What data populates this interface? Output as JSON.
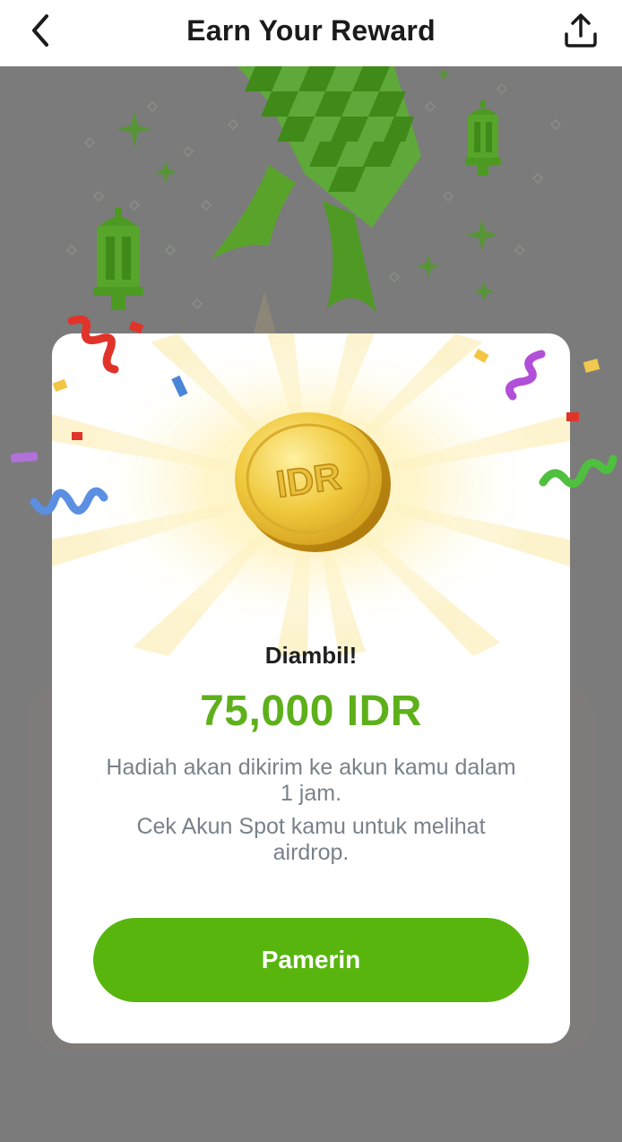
{
  "header": {
    "title": "Earn Your Reward",
    "back_icon": "chevron-left-icon",
    "share_icon": "share-upload-icon"
  },
  "reward": {
    "coin_label": "IDR",
    "status": "Diambil!",
    "amount": "75,000 IDR",
    "description_1": "Hadiah akan dikirim ke akun kamu dalam 1 jam.",
    "description_2": "Cek Akun Spot kamu untuk melihat airdrop.",
    "button_label": "Pamerin"
  },
  "colors": {
    "accent_green": "#58b50e",
    "amount_green": "#5db01a",
    "overlay_gray": "#7b7b7b",
    "coin_gold": "#e3b832"
  }
}
